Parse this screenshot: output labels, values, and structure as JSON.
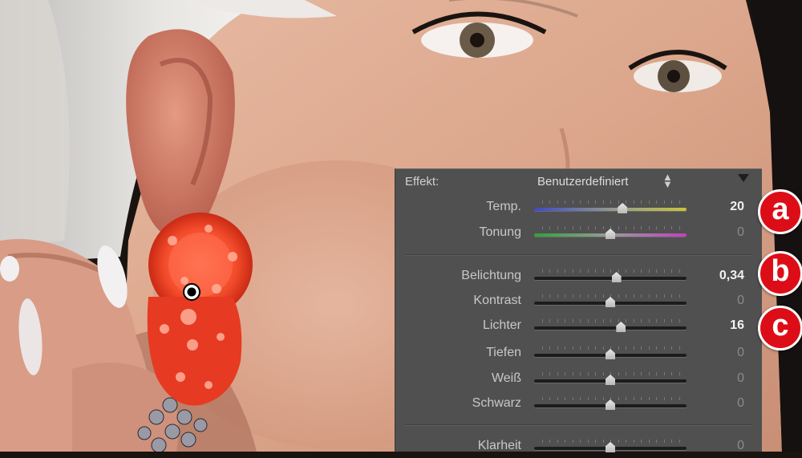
{
  "panel": {
    "effect_label": "Effekt:",
    "effect_value": "Benutzerdefiniert",
    "arrows_icon": "up-down-arrows-icon",
    "collapse_icon": "triangle-down-icon",
    "sliders": [
      {
        "id": "temp",
        "label": "Temp.",
        "value": "20",
        "position": 0.58
      },
      {
        "id": "tint",
        "label": "Tonung",
        "value": "0",
        "position": 0.5
      },
      {
        "id": "exposure",
        "label": "Belichtung",
        "value": "0,34",
        "position": 0.54
      },
      {
        "id": "contrast",
        "label": "Kontrast",
        "value": "0",
        "position": 0.5
      },
      {
        "id": "highlights",
        "label": "Lichter",
        "value": "16",
        "position": 0.57
      },
      {
        "id": "shadows",
        "label": "Tiefen",
        "value": "0",
        "position": 0.5
      },
      {
        "id": "whites",
        "label": "Weiß",
        "value": "0",
        "position": 0.5
      },
      {
        "id": "blacks",
        "label": "Schwarz",
        "value": "0",
        "position": 0.5
      },
      {
        "id": "clarity",
        "label": "Klarheit",
        "value": "0",
        "position": 0.5
      }
    ]
  },
  "badges": [
    "a",
    "b",
    "c"
  ],
  "colors": {
    "panel_bg": "#505050",
    "badge_red": "#dd0d18",
    "pin": "#000000"
  }
}
